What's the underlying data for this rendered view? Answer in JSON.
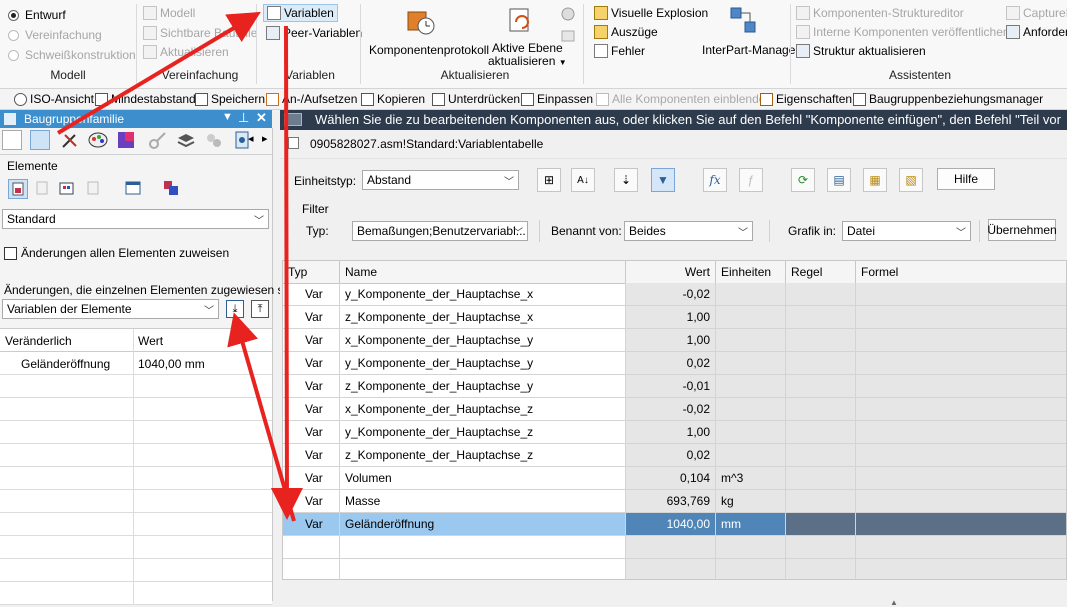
{
  "ribbon": {
    "modell": {
      "options": [
        "Entwurf",
        "Vereinfachung",
        "Schweißkonstruktion"
      ],
      "label": "Modell"
    },
    "vereinfachung": {
      "items": [
        "Modell",
        "Sichtbare Bauteile",
        "Aktualisieren"
      ],
      "label": "Vereinfachung"
    },
    "variablen": {
      "items": [
        "Variablen",
        "Peer-Variablen"
      ],
      "label": "Variablen"
    },
    "aktualisieren": {
      "items": [
        "Komponentenprotokoll",
        "Aktive Ebene",
        "aktualisieren"
      ],
      "label": "Aktualisieren"
    },
    "explosion": {
      "items": [
        "Visuelle Explosion",
        "Auszüge",
        "Fehler"
      ]
    },
    "interpart": {
      "label": "InterPart-Manager"
    },
    "assistenten": {
      "items": [
        "Komponenten-Struktureditor",
        "Interne Komponenten veröffentlichen",
        "Struktur aktualisieren",
        "CaptureFit",
        "Anforderu"
      ],
      "label": "Assistenten"
    }
  },
  "toolbar": {
    "items": [
      "ISO-Ansicht",
      "Mindestabstand",
      "Speichern",
      "An-/Aufsetzen",
      "Kopieren",
      "Unterdrücken",
      "Einpassen",
      "Alle Komponenten einblenden",
      "Eigenschaften",
      "Baugruppenbeziehungsmanager"
    ]
  },
  "left_panel": {
    "title": "Baugruppenfamilie",
    "elemente_label": "Elemente",
    "standard_select": "Standard",
    "checkbox_label": "Änderungen allen Elementen zuweisen",
    "changes_label": "Änderungen, die einzelnen Elementen zugewiesen sind:",
    "changes_select": "Variablen der Elemente",
    "table": {
      "headers": [
        "Veränderlich",
        "Wert"
      ],
      "rows": [
        {
          "name": "Geländeröffnung",
          "value": "1040,00 mm"
        }
      ]
    }
  },
  "message_bar": {
    "text": "Wählen Sie die zu bearbeitenden Komponenten aus, oder klicken Sie auf den Befehl \"Komponente einfügen\", den Befehl \"Teil vor"
  },
  "variable_table": {
    "title": "0905828027.asm!Standard:Variablentabelle",
    "einheitstyp_label": "Einheitstyp:",
    "einheitstyp_value": "Abstand",
    "fx_label": "fx",
    "hilfe": "Hilfe",
    "filter_label": "Filter",
    "typ_label": "Typ:",
    "typ_value": "Bemaßungen;Benutzervariabl...",
    "benannt_label": "Benannt von:",
    "benannt_value": "Beides",
    "grafik_label": "Grafik in:",
    "grafik_value": "Datei",
    "uebernehmen": "Übernehmen",
    "columns": [
      "Typ",
      "Name",
      "Wert",
      "Einheiten",
      "Regel",
      "Formel"
    ],
    "rows": [
      {
        "typ": "Var",
        "name": "y_Komponente_der_Hauptachse_x",
        "wert": "-0,02",
        "einheit": ""
      },
      {
        "typ": "Var",
        "name": "z_Komponente_der_Hauptachse_x",
        "wert": "1,00",
        "einheit": ""
      },
      {
        "typ": "Var",
        "name": "x_Komponente_der_Hauptachse_y",
        "wert": "1,00",
        "einheit": ""
      },
      {
        "typ": "Var",
        "name": "y_Komponente_der_Hauptachse_y",
        "wert": "0,02",
        "einheit": ""
      },
      {
        "typ": "Var",
        "name": "z_Komponente_der_Hauptachse_y",
        "wert": "-0,01",
        "einheit": ""
      },
      {
        "typ": "Var",
        "name": "x_Komponente_der_Hauptachse_z",
        "wert": "-0,02",
        "einheit": ""
      },
      {
        "typ": "Var",
        "name": "y_Komponente_der_Hauptachse_z",
        "wert": "1,00",
        "einheit": ""
      },
      {
        "typ": "Var",
        "name": "z_Komponente_der_Hauptachse_z",
        "wert": "0,02",
        "einheit": ""
      },
      {
        "typ": "Var",
        "name": "Volumen",
        "wert": "0,104",
        "einheit": "m^3"
      },
      {
        "typ": "Var",
        "name": "Masse",
        "wert": "693,769",
        "einheit": "kg"
      },
      {
        "typ": "Var",
        "name": "Geländeröffnung",
        "wert": "1040,00",
        "einheit": "mm"
      }
    ]
  },
  "colors": {
    "accent_blue": "#3c8fcc",
    "selection_row": "#9ac8ee",
    "annotation_arrow": "#e8231f"
  }
}
